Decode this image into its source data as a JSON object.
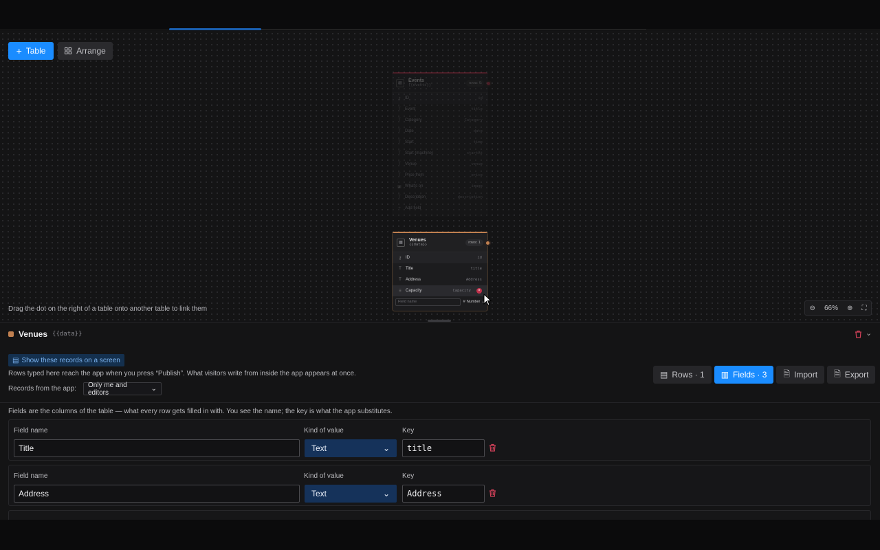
{
  "canvas": {
    "add_table_label": "Table",
    "arrange_label": "Arrange",
    "hint": "Drag the dot on the right of a table onto another table to link them",
    "zoom_level": "66%",
    "events_node": {
      "title": "Events",
      "key": "{{events}}",
      "rows_badge": "rows: 6",
      "fields": [
        {
          "name": "ID",
          "key": "id"
        },
        {
          "name": "Event",
          "key": "title"
        },
        {
          "name": "Category",
          "key": "Category"
        },
        {
          "name": "Date",
          "key": "date"
        },
        {
          "name": "Start",
          "key": "time"
        },
        {
          "name": "Start (machine)",
          "key": "startAt"
        },
        {
          "name": "Venue",
          "key": "venue"
        },
        {
          "name": "Price from",
          "key": "price"
        },
        {
          "name": "What's on",
          "key": "image"
        },
        {
          "name": "Description",
          "key": "description"
        }
      ],
      "add_field_label": "Add field"
    },
    "venues_node": {
      "title": "Venues",
      "key": "{{data}}",
      "rows_badge": "rows: 1",
      "fields": [
        {
          "name": "ID",
          "key": "id"
        },
        {
          "name": "Title",
          "key": "title"
        },
        {
          "name": "Address",
          "key": "Address"
        },
        {
          "name": "Capacity",
          "key": "Capacity"
        }
      ],
      "new_field_placeholder": "Field name",
      "new_field_type": "Number"
    }
  },
  "panel": {
    "table_name": "Venues",
    "table_key": "{{data}}",
    "show_on_screen_label": "Show these records on a screen",
    "publish_info": "Rows typed here reach the app when you press “Publish”. What visitors write from inside the app appears at once.",
    "records_from_app_label": "Records from the app:",
    "records_from_app_value": "Only me and editors",
    "tabs": {
      "rows": "Rows · 1",
      "fields": "Fields · 3",
      "import": "Import",
      "export": "Export"
    },
    "fields_info": "Fields are the columns of the table — what every row gets filled in with. You see the name; the key is what the app substitutes.",
    "field_rows": [
      {
        "field_name_label": "Field name",
        "kind_label": "Kind of value",
        "key_label": "Key",
        "name": "Title",
        "kind": "Text",
        "key": "title"
      },
      {
        "field_name_label": "Field name",
        "kind_label": "Kind of value",
        "key_label": "Key",
        "name": "Address",
        "kind": "Text",
        "key": "Address"
      }
    ]
  },
  "colors": {
    "accent": "#1a8cff",
    "venues_color": "#c08050",
    "events_color": "#c0304a",
    "danger": "#d04058"
  }
}
